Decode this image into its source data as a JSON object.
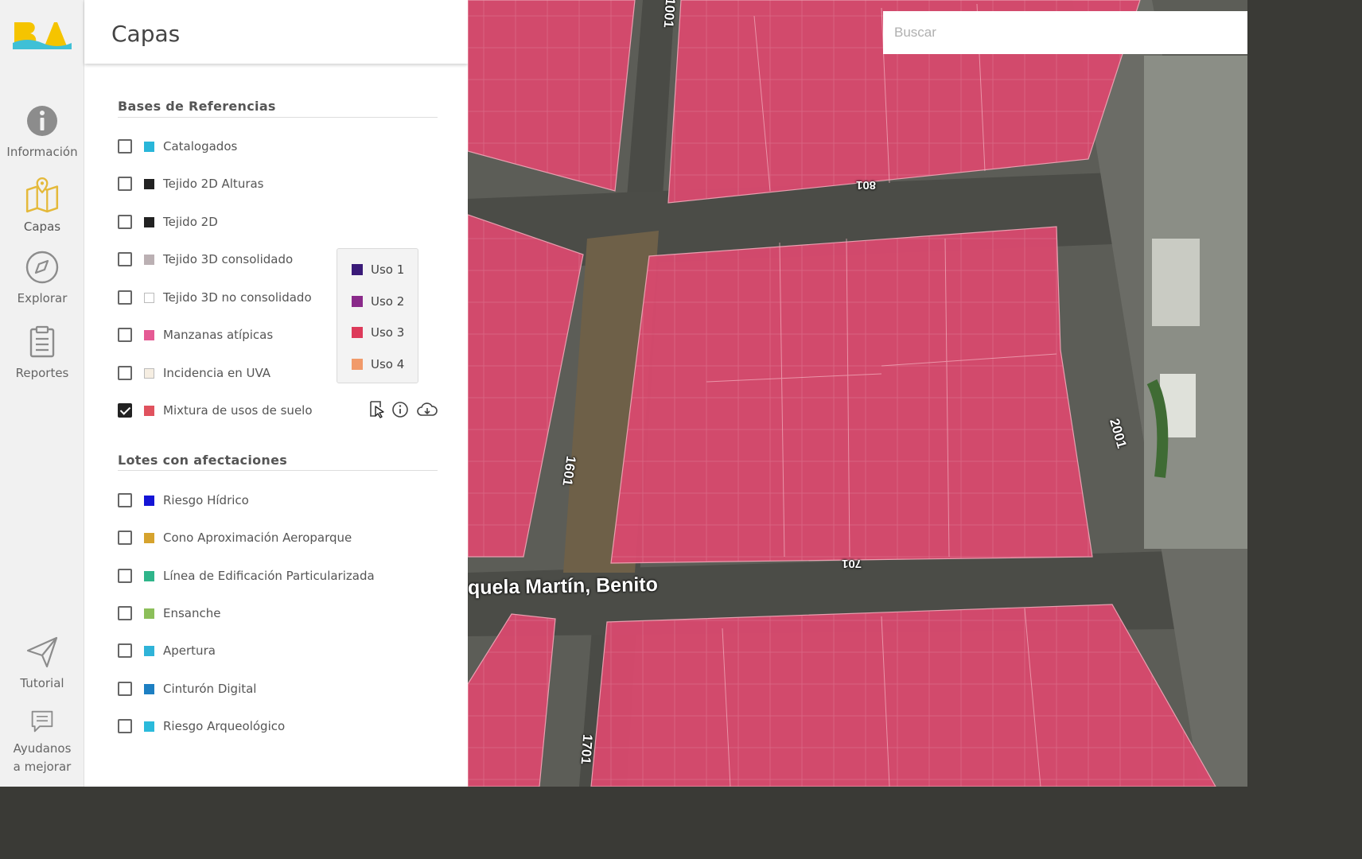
{
  "rail": {
    "logo_text": "BA",
    "items": [
      {
        "label": "Información",
        "icon": "info-icon"
      },
      {
        "label": "Capas",
        "icon": "map-layers-icon"
      },
      {
        "label": "Explorar",
        "icon": "compass-icon"
      },
      {
        "label": "Reportes",
        "icon": "clipboard-icon"
      },
      {
        "label": "Tutorial",
        "icon": "paper-plane-icon"
      },
      {
        "label": "Ayudanos a mejorar",
        "icon": "feedback-icon"
      }
    ]
  },
  "panel": {
    "title": "Capas",
    "sections": [
      {
        "title": "Bases de Referencias",
        "items": [
          {
            "label": "Catalogados",
            "color": "#29b6d9",
            "checked": false
          },
          {
            "label": "Tejido 2D Alturas",
            "color": "#222222",
            "checked": false
          },
          {
            "label": "Tejido 2D",
            "color": "#222222",
            "checked": false
          },
          {
            "label": "Tejido 3D consolidado",
            "color": "#bbb0b3",
            "checked": false
          },
          {
            "label": "Tejido 3D no consolidado",
            "color": "#ffffff",
            "checked": false
          },
          {
            "label": "Manzanas atípicas",
            "color": "#e55a94",
            "checked": false
          },
          {
            "label": "Incidencia en UVA",
            "color": "#f6eee2",
            "checked": false
          },
          {
            "label": "Mixtura de usos de suelo",
            "color": "#e0525e",
            "checked": true
          }
        ]
      },
      {
        "title": "Lotes con afectaciones",
        "items": [
          {
            "label": "Riesgo Hídrico",
            "color": "#1414d6",
            "checked": false
          },
          {
            "label": "Cono Aproximación Aeroparque",
            "color": "#d6a32e",
            "checked": false
          },
          {
            "label": "Línea de Edificación Particularizada",
            "color": "#2fb58a",
            "checked": false
          },
          {
            "label": "Ensanche",
            "color": "#8cbf5a",
            "checked": false
          },
          {
            "label": "Apertura",
            "color": "#2fb3d8",
            "checked": false
          },
          {
            "label": "Cinturón Digital",
            "color": "#1d7fc2",
            "checked": false
          },
          {
            "label": "Riesgo Arqueológico",
            "color": "#2bbadb",
            "checked": false
          }
        ]
      }
    ],
    "uso_legend": [
      {
        "label": "Uso 1",
        "color": "#3a1a78"
      },
      {
        "label": "Uso 2",
        "color": "#8a2a8a"
      },
      {
        "label": "Uso 3",
        "color": "#dd3a5a"
      },
      {
        "label": "Uso 4",
        "color": "#f19a6a"
      }
    ],
    "row_actions": [
      "select-pointer-icon",
      "info-circle-icon",
      "cloud-download-icon"
    ]
  },
  "map": {
    "search_placeholder": "Buscar",
    "street_labels": [
      "quela Martín, Benito",
      "1001",
      "1601",
      "1701",
      "2001",
      "801",
      "701"
    ],
    "overlay_color": "#e0456e"
  }
}
